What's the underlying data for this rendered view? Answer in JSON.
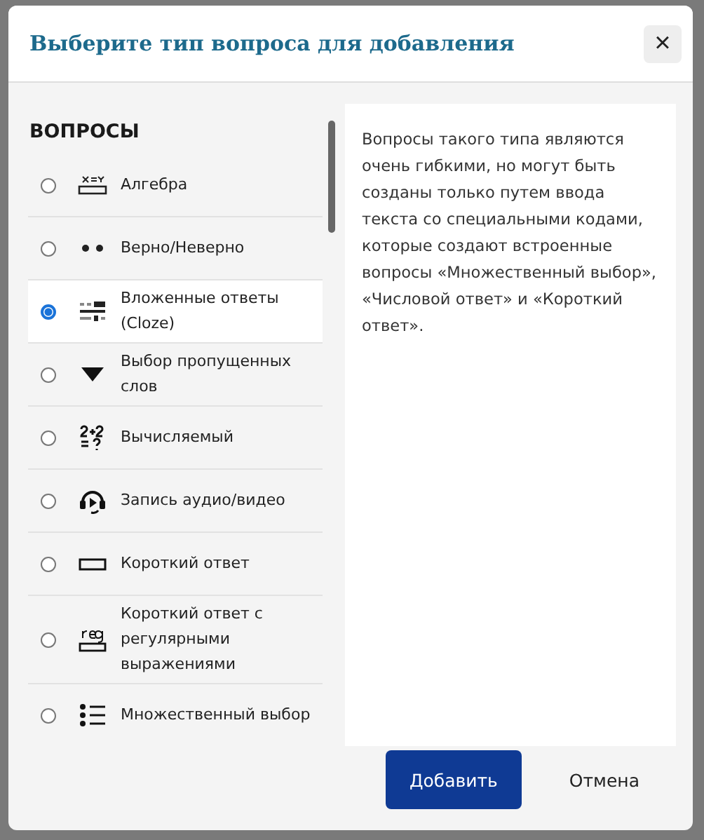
{
  "dialog": {
    "title": "Выберите тип вопроса для добавления",
    "close": "×"
  },
  "section": {
    "heading": "ВОПРОСЫ"
  },
  "options": [
    {
      "label": "Алгебра",
      "kind": "algebra",
      "selected": false
    },
    {
      "label": "Верно/Неверно",
      "kind": "truefalse",
      "selected": false
    },
    {
      "label": "Вложенные ответы (Cloze)",
      "kind": "cloze",
      "selected": true
    },
    {
      "label": "Выбор пропущенных слов",
      "kind": "dropdown",
      "selected": false
    },
    {
      "label": "Вычисляемый",
      "kind": "calculated",
      "selected": false
    },
    {
      "label": "Запись аудио/видео",
      "kind": "recording",
      "selected": false
    },
    {
      "label": "Короткий ответ",
      "kind": "shortanswer",
      "selected": false
    },
    {
      "label": "Короткий ответ с регулярными выражениями",
      "kind": "regexp",
      "selected": false
    },
    {
      "label": "Множественный выбор",
      "kind": "multichoice",
      "selected": false
    }
  ],
  "description": "Вопросы такого типа являются очень гибкими, но могут быть созданы только путем ввода текста со специальными кодами, которые создают встроенные вопросы «Множественный выбор», «Числовой ответ» и «Короткий ответ».",
  "buttons": {
    "primary": "Добавить",
    "secondary": "Отмена"
  }
}
